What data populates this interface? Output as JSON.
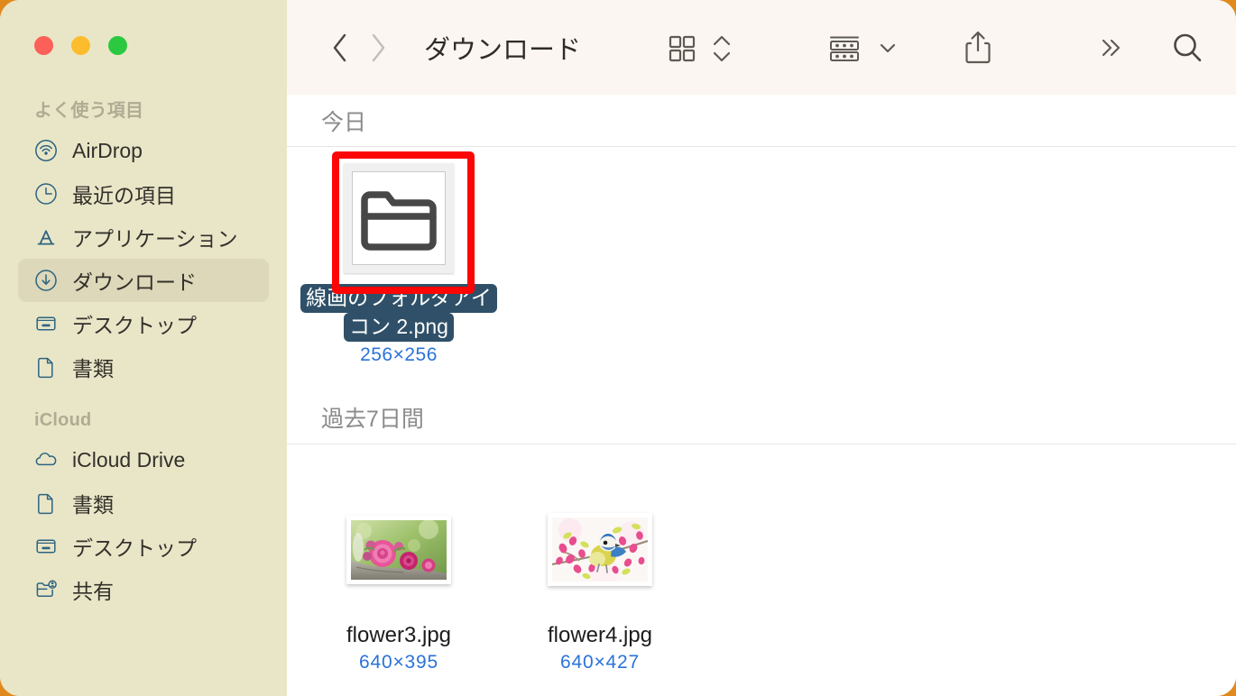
{
  "window": {
    "title": "ダウンロード",
    "traffic_lights": [
      {
        "name": "close",
        "color": "#fc6058"
      },
      {
        "name": "minimize",
        "color": "#fdbc2e"
      },
      {
        "name": "maximize",
        "color": "#2cc840"
      }
    ]
  },
  "toolbar": {
    "back_icon": "chevron-left-icon",
    "forward_icon": "chevron-right-icon",
    "title": "ダウンロード",
    "view_icon": "grid-view-icon",
    "view_stepper_icon": "chevron-up-down-icon",
    "group_icon": "group-by-icon",
    "group_chevron_icon": "chevron-down-icon",
    "share_icon": "share-icon",
    "more_icon": "double-chevron-right-icon",
    "search_icon": "search-icon"
  },
  "sidebar": {
    "sections": [
      {
        "header": "よく使う項目",
        "items": [
          {
            "label": "AirDrop",
            "icon": "airdrop-icon",
            "selected": false
          },
          {
            "label": "最近の項目",
            "icon": "clock-icon",
            "selected": false
          },
          {
            "label": "アプリケーション",
            "icon": "applications-icon",
            "selected": false
          },
          {
            "label": "ダウンロード",
            "icon": "downloads-icon",
            "selected": true
          },
          {
            "label": "デスクトップ",
            "icon": "desktop-icon",
            "selected": false
          },
          {
            "label": "書類",
            "icon": "document-icon",
            "selected": false
          }
        ]
      },
      {
        "header": "iCloud",
        "items": [
          {
            "label": "iCloud Drive",
            "icon": "cloud-icon",
            "selected": false
          },
          {
            "label": "書類",
            "icon": "document-icon",
            "selected": false
          },
          {
            "label": "デスクトップ",
            "icon": "desktop-icon",
            "selected": false
          },
          {
            "label": "共有",
            "icon": "shared-folder-icon",
            "selected": false
          }
        ]
      }
    ],
    "colors": {
      "background": "#e9e6c8",
      "icon": "#2d6480",
      "selected_background": "#dcd8b9",
      "header_text": "#b0ab93"
    }
  },
  "content": {
    "groups": [
      {
        "header": "今日",
        "files": [
          {
            "name_lines": [
              "線画のフォルダアイ",
              "コン 2.png"
            ],
            "full_name": "線画のフォルダアイコン 2.png",
            "dimensions": "256×256",
            "thumb": "folder-line-art",
            "selected": true,
            "highlighted": true
          }
        ]
      },
      {
        "header": "過去7日間",
        "files": [
          {
            "name_lines": [
              "flower3.jpg"
            ],
            "full_name": "flower3.jpg",
            "dimensions": "640×395",
            "thumb": "roses-photo",
            "selected": false,
            "highlighted": false
          },
          {
            "name_lines": [
              "flower4.jpg"
            ],
            "full_name": "flower4.jpg",
            "dimensions": "640×427",
            "thumb": "bluetit-photo",
            "selected": false,
            "highlighted": false
          }
        ]
      }
    ]
  },
  "colors": {
    "desktop_background": "#e08a1e",
    "highlight_red": "#fc0505",
    "selection_blue": "#2f5068",
    "dimension_text": "#2b73d8"
  }
}
